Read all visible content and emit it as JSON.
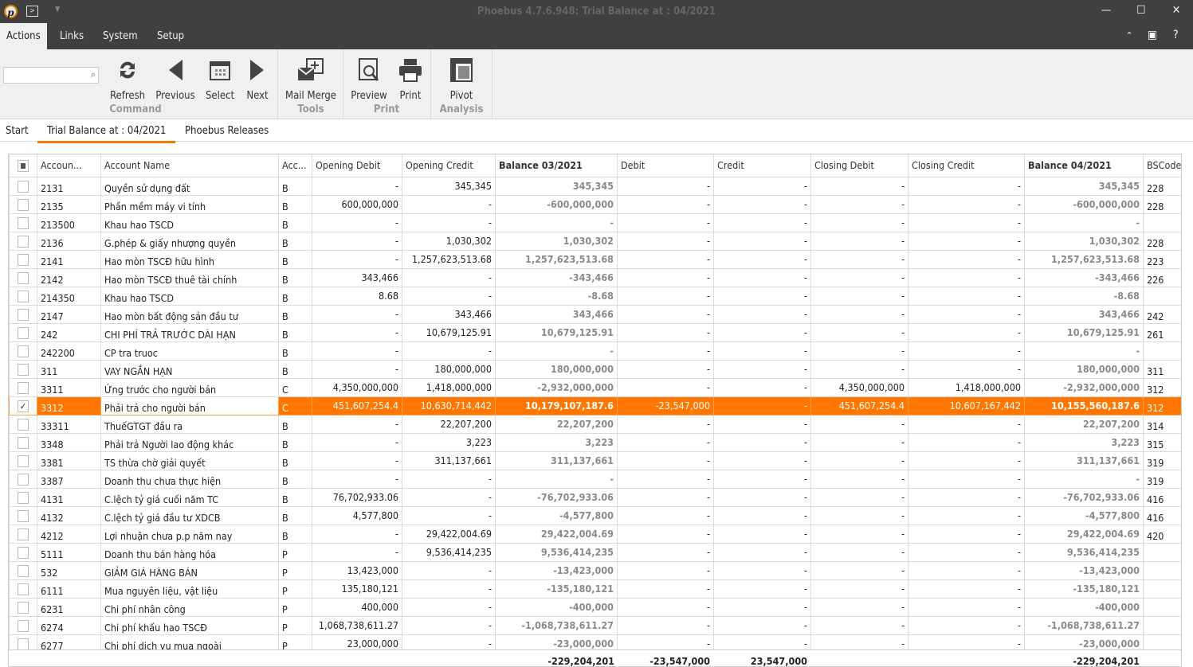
{
  "window": {
    "title": "Phoebus 4.7.6.948: Trial Balance at : 04/2021"
  },
  "menu": [
    "Actions",
    "Links",
    "System",
    "Setup"
  ],
  "ribbon": {
    "search_placeholder": "",
    "buttons": [
      {
        "label": "Refresh",
        "icon": "refresh-icon"
      },
      {
        "label": "Previous",
        "icon": "triangle-left-icon"
      },
      {
        "label": "Select",
        "icon": "calendar-icon"
      },
      {
        "label": "Next",
        "icon": "triangle-right-icon"
      },
      {
        "label": "Mail Merge",
        "icon": "mail-merge-icon"
      },
      {
        "label": "Preview",
        "icon": "preview-icon"
      },
      {
        "label": "Print",
        "icon": "printer-icon"
      },
      {
        "label": "Pivot",
        "icon": "pivot-icon"
      }
    ],
    "groups": [
      "Command",
      "Tools",
      "Print",
      "Analysis"
    ]
  },
  "tabs": [
    "Start",
    "Trial Balance at : 04/2021",
    "Phoebus Releases"
  ],
  "grid": {
    "columns": [
      "Accoun...",
      "Account Name",
      "Acc...",
      "Opening Debit",
      "Opening Credit",
      "Balance 03/2021",
      "Debit",
      "Credit",
      "Closing Debit",
      "Closing Credit",
      "Balance 04/2021",
      "BSCode"
    ],
    "selected_index": 12,
    "rows": [
      [
        "2131",
        "Quyền sử dụng đất",
        "B",
        "-",
        "345,345",
        "345,345",
        "-",
        "-",
        "-",
        "-",
        "345,345",
        "228"
      ],
      [
        "2135",
        "Phần mềm máy vi tính",
        "B",
        "600,000,000",
        "-",
        "-600,000,000",
        "-",
        "-",
        "-",
        "-",
        "-600,000,000",
        "228"
      ],
      [
        "213500",
        "Khau hao TSCD",
        "B",
        "-",
        "-",
        "-",
        "-",
        "-",
        "-",
        "-",
        "-",
        ""
      ],
      [
        "2136",
        "G.phép & giấy nhượng quyền",
        "B",
        "-",
        "1,030,302",
        "1,030,302",
        "-",
        "-",
        "-",
        "-",
        "1,030,302",
        "228"
      ],
      [
        "2141",
        "Hao mòn TSCĐ hữu hình",
        "B",
        "-",
        "1,257,623,513.68",
        "1,257,623,513.68",
        "-",
        "-",
        "-",
        "-",
        "1,257,623,513.68",
        "223"
      ],
      [
        "2142",
        "Hao mòn TSCĐ thuê tài chính",
        "B",
        "343,466",
        "-",
        "-343,466",
        "-",
        "-",
        "-",
        "-",
        "-343,466",
        "226"
      ],
      [
        "214350",
        "Khau hao TSCD",
        "B",
        "8.68",
        "-",
        "-8.68",
        "-",
        "-",
        "-",
        "-",
        "-8.68",
        ""
      ],
      [
        "2147",
        "Hao mòn bất động sản đầu tư",
        "B",
        "-",
        "343,466",
        "343,466",
        "-",
        "-",
        "-",
        "-",
        "343,466",
        "242"
      ],
      [
        "242",
        "CHI PHÍ TRẢ TRƯỚC DÀI HẠN",
        "B",
        "-",
        "10,679,125.91",
        "10,679,125.91",
        "-",
        "-",
        "-",
        "-",
        "10,679,125.91",
        "261"
      ],
      [
        "242200",
        "CP tra truoc",
        "B",
        "-",
        "-",
        "-",
        "-",
        "-",
        "-",
        "-",
        "-",
        ""
      ],
      [
        "311",
        "VAY NGẮN HẠN",
        "B",
        "-",
        "180,000,000",
        "180,000,000",
        "-",
        "-",
        "-",
        "-",
        "180,000,000",
        "311"
      ],
      [
        "3311",
        "Ứng trước cho người bán",
        "C",
        "4,350,000,000",
        "1,418,000,000",
        "-2,932,000,000",
        "-",
        "-",
        "4,350,000,000",
        "1,418,000,000",
        "-2,932,000,000",
        "312"
      ],
      [
        "3312",
        "Phải trả cho người bán",
        "C",
        "451,607,254.4",
        "10,630,714,442",
        "10,179,107,187.6",
        "-23,547,000",
        "-",
        "451,607,254.4",
        "10,607,167,442",
        "10,155,560,187.6",
        "312"
      ],
      [
        "33311",
        "ThuếGTGT đầu ra",
        "B",
        "-",
        "22,207,200",
        "22,207,200",
        "-",
        "-",
        "-",
        "-",
        "22,207,200",
        "314"
      ],
      [
        "3348",
        "Phải trả Người lao động khác",
        "B",
        "-",
        "3,223",
        "3,223",
        "-",
        "-",
        "-",
        "-",
        "3,223",
        "315"
      ],
      [
        "3381",
        "TS thừa chờ giải quyết",
        "B",
        "-",
        "311,137,661",
        "311,137,661",
        "-",
        "-",
        "-",
        "-",
        "311,137,661",
        "319"
      ],
      [
        "3387",
        "Doanh thu chưa thực hiện",
        "B",
        "-",
        "-",
        "-",
        "-",
        "-",
        "-",
        "-",
        "-",
        "319"
      ],
      [
        "4131",
        "C.lệch tỷ giá  cuối năm TC",
        "B",
        "76,702,933.06",
        "-",
        "-76,702,933.06",
        "-",
        "-",
        "-",
        "-",
        "-76,702,933.06",
        "416"
      ],
      [
        "4132",
        "C.lệch tỷ giá đầu tư XDCB",
        "B",
        "4,577,800",
        "-",
        "-4,577,800",
        "-",
        "-",
        "-",
        "-",
        "-4,577,800",
        "416"
      ],
      [
        "4212",
        "Lợi nhuận chưa p.p năm nay",
        "B",
        "-",
        "29,422,004.69",
        "29,422,004.69",
        "-",
        "-",
        "-",
        "-",
        "29,422,004.69",
        "420"
      ],
      [
        "5111",
        "Doanh thu bán hàng hóa",
        "P",
        "-",
        "9,536,414,235",
        "9,536,414,235",
        "-",
        "-",
        "-",
        "-",
        "9,536,414,235",
        ""
      ],
      [
        "532",
        "GIẢM GIÁ HÀNG BÁN",
        "P",
        "13,423,000",
        "-",
        "-13,423,000",
        "-",
        "-",
        "-",
        "-",
        "-13,423,000",
        ""
      ],
      [
        "6111",
        "Mua nguyên liệu, vật liệu",
        "P",
        "135,180,121",
        "-",
        "-135,180,121",
        "-",
        "-",
        "-",
        "-",
        "-135,180,121",
        ""
      ],
      [
        "6231",
        "Chi phí nhân công",
        "P",
        "400,000",
        "-",
        "-400,000",
        "-",
        "-",
        "-",
        "-",
        "-400,000",
        ""
      ],
      [
        "6274",
        "Chi phí khấu hao TSCĐ",
        "P",
        "1,068,738,611.27",
        "-",
        "-1,068,738,611.27",
        "-",
        "-",
        "-",
        "-",
        "-1,068,738,611.27",
        ""
      ],
      [
        "6277",
        "Chi phí dịch vụ mua ngoài",
        "P",
        "23,000,000",
        "-",
        "-23,000,000",
        "-",
        "-",
        "-",
        "-",
        "-23,000,000",
        ""
      ]
    ],
    "totals": {
      "balance_03": "-229,204,201",
      "debit": "-23,547,000",
      "credit": "23,547,000",
      "balance_04": "-229,204,201"
    }
  },
  "colors": {
    "accent": "#ff7700",
    "chrome": "#404040"
  }
}
